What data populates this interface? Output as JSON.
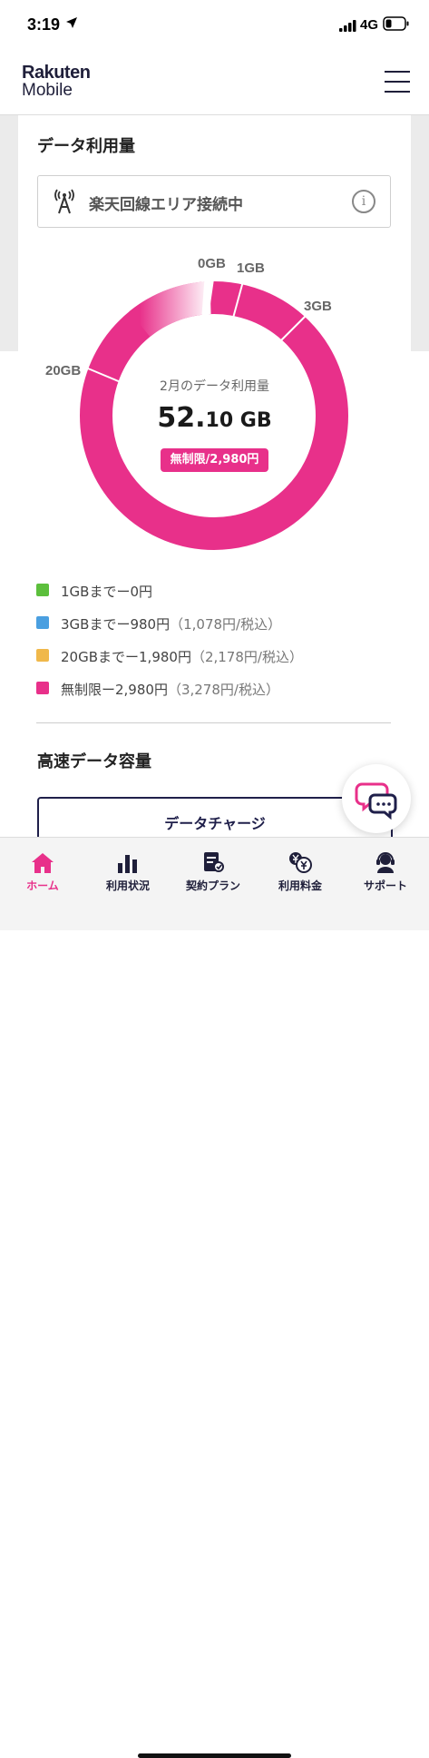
{
  "status_bar": {
    "time": "3:19",
    "network": "4G"
  },
  "header": {
    "logo_line1": "Rakuten",
    "logo_line2": "Mobile"
  },
  "data_usage": {
    "title": "データ利用量",
    "area_status": "楽天回線エリア接続中",
    "info_glyph": "i",
    "ring_labels": [
      "0GB",
      "1GB",
      "3GB",
      "20GB"
    ],
    "center_label": "2月のデータ利用量",
    "usage_int": "52.",
    "usage_dec": "10",
    "usage_unit": " GB",
    "usage_value_gb": 52.1,
    "plan_badge": "無制限/2,980円",
    "accent_color": "#e8308a"
  },
  "legend": [
    {
      "text": "1GBまでー0円",
      "tax": "",
      "color": "#5cbf3c"
    },
    {
      "text": "3GBまでー980円",
      "tax": "（1,078円/税込）",
      "color": "#4a9fe0"
    },
    {
      "text": "20GBまでー1,980円",
      "tax": "（2,178円/税込）",
      "color": "#f0b84a"
    },
    {
      "text": "無制限ー2,980円",
      "tax": "（3,278円/税込）",
      "color": "#e8308a"
    }
  ],
  "high_speed": {
    "title": "高速データ容量",
    "charge_button": "データチャージ"
  },
  "tabs": [
    {
      "label": "ホーム",
      "icon": "home-icon",
      "active": true
    },
    {
      "label": "利用状況",
      "icon": "bar-chart-icon",
      "active": false
    },
    {
      "label": "契約プラン",
      "icon": "contract-icon",
      "active": false
    },
    {
      "label": "利用料金",
      "icon": "fee-icon",
      "active": false
    },
    {
      "label": "サポート",
      "icon": "support-icon",
      "active": false
    }
  ]
}
